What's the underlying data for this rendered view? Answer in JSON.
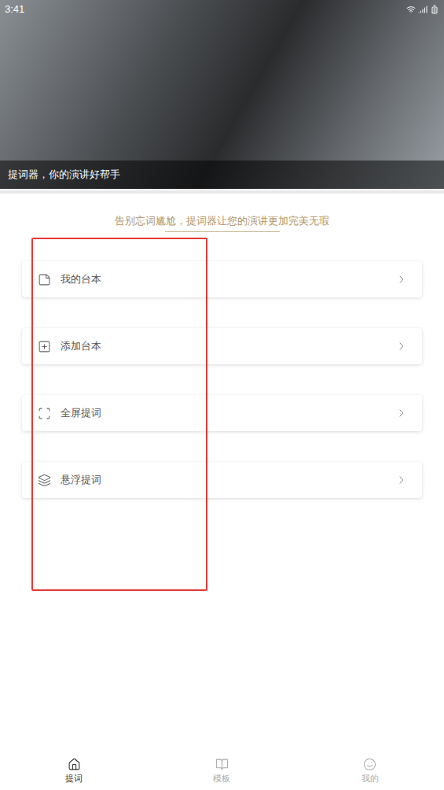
{
  "status_bar": {
    "time": "3:41"
  },
  "banner": {
    "caption": "提词器，你的演讲好帮手"
  },
  "tagline": "告别忘词尴尬，提词器让您的演讲更加完美无瑕",
  "menu": [
    {
      "label": "我的台本"
    },
    {
      "label": "添加台本"
    },
    {
      "label": "全屏提词"
    },
    {
      "label": "悬浮提词"
    }
  ],
  "tabs": [
    {
      "label": "提词",
      "selected": true
    },
    {
      "label": "模板",
      "selected": false
    },
    {
      "label": "我的",
      "selected": false
    }
  ]
}
